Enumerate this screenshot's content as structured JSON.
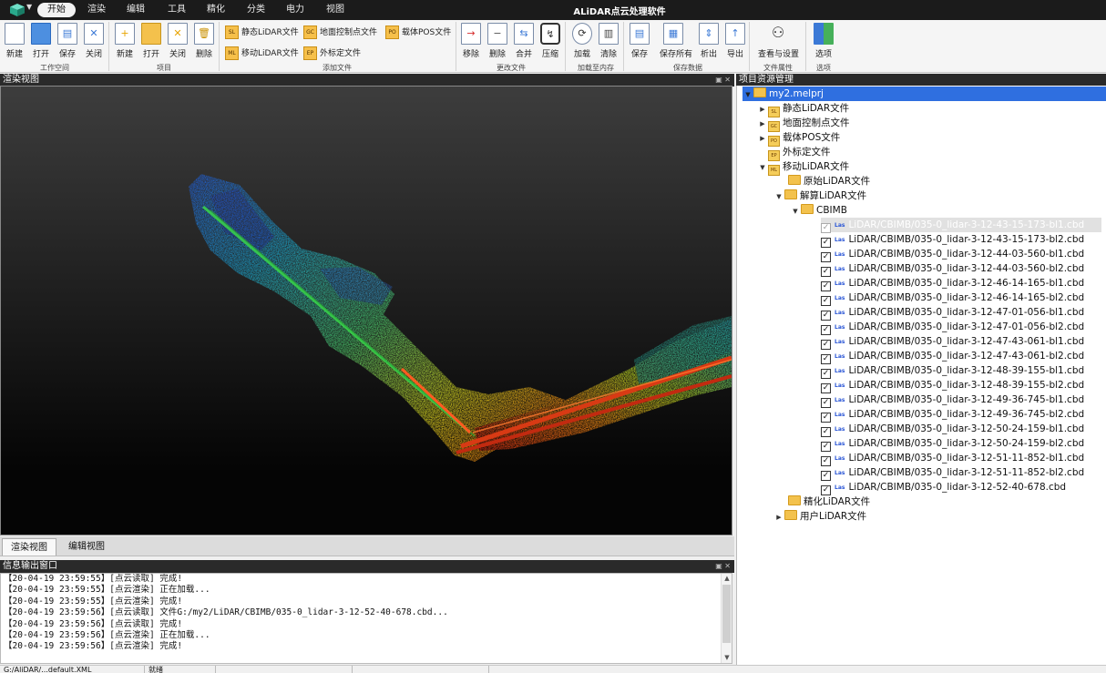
{
  "titlebar": {
    "app_title": "ALiDAR点云处理软件",
    "tabs": [
      "开始",
      "渲染",
      "编辑",
      "工具",
      "精化",
      "分类",
      "电力",
      "视图"
    ],
    "active_tab": 0,
    "app_icon": "cube-logo-icon"
  },
  "ribbon": {
    "groups": {
      "workspace": "工作空间",
      "project": "项目",
      "add_file": "添加文件",
      "change_file": "更改文件",
      "load_memory": "加载至内存",
      "save_data": "保存数据",
      "file_props": "文件属性",
      "options": "选项"
    },
    "workspace": {
      "new": "新建",
      "open": "打开",
      "save": "保存",
      "close": "关闭"
    },
    "project": {
      "new": "新建",
      "open": "打开",
      "close": "关闭",
      "delete": "删除"
    },
    "add_file": {
      "static_lidar": "静态LiDAR文件",
      "static_lidar_tag": "SL",
      "mobile_lidar": "移动LiDAR文件",
      "mobile_lidar_tag": "ML",
      "ground_control": "地面控制点文件",
      "ground_control_tag": "GC",
      "extrinsic": "外标定文件",
      "extrinsic_tag": "EP",
      "pos": "载体POS文件",
      "pos_tag": "PO"
    },
    "change_file": {
      "remove": "移除",
      "delete": "删除",
      "merge": "合并",
      "compress": "压缩"
    },
    "load_memory": {
      "load": "加载",
      "clear": "清除"
    },
    "save_data": {
      "save": "保存",
      "save_all": "保存所有",
      "extract": "析出",
      "export": "导出"
    },
    "file_props": {
      "view_settings": "查看与设置"
    },
    "options": {
      "options": "选项"
    }
  },
  "render_panel": {
    "title": "渲染视图",
    "tabs": [
      "渲染视图",
      "编辑视图"
    ],
    "active_tab": 0
  },
  "log_panel": {
    "title": "信息输出窗口",
    "lines": [
      "【20-04-19 23:59:55】[点云读取] 完成!",
      "【20-04-19 23:59:55】[点云渲染] 正在加载...",
      "【20-04-19 23:59:55】[点云渲染] 完成!",
      "【20-04-19 23:59:56】[点云读取] 文件G:/my2/LiDAR/CBIMB/035-0_lidar-3-12-52-40-678.cbd...",
      "【20-04-19 23:59:56】[点云读取] 完成!",
      "【20-04-19 23:59:56】[点云渲染] 正在加载...",
      "【20-04-19 23:59:56】[点云渲染] 完成!"
    ]
  },
  "tree_panel": {
    "title": "项目资源管理",
    "project": "my2.melprj",
    "static_lidar": "静态LiDAR文件",
    "static_lidar_tag": "SL",
    "ground_control": "地面控制点文件",
    "ground_control_tag": "GC",
    "pos": "载体POS文件",
    "pos_tag": "PO",
    "extrinsic": "外标定文件",
    "extrinsic_tag": "EP",
    "mobile_lidar": "移动LiDAR文件",
    "mobile_lidar_tag": "ML",
    "raw_lidar": "原始LiDAR文件",
    "solved_lidar": "解算LiDAR文件",
    "cbimb": "CBIMB",
    "las_tag": "Las",
    "files": [
      "LiDAR/CBIMB/035-0_lidar-3-12-43-15-173-bl1.cbd",
      "LiDAR/CBIMB/035-0_lidar-3-12-43-15-173-bl2.cbd",
      "LiDAR/CBIMB/035-0_lidar-3-12-44-03-560-bl1.cbd",
      "LiDAR/CBIMB/035-0_lidar-3-12-44-03-560-bl2.cbd",
      "LiDAR/CBIMB/035-0_lidar-3-12-46-14-165-bl1.cbd",
      "LiDAR/CBIMB/035-0_lidar-3-12-46-14-165-bl2.cbd",
      "LiDAR/CBIMB/035-0_lidar-3-12-47-01-056-bl1.cbd",
      "LiDAR/CBIMB/035-0_lidar-3-12-47-01-056-bl2.cbd",
      "LiDAR/CBIMB/035-0_lidar-3-12-47-43-061-bl1.cbd",
      "LiDAR/CBIMB/035-0_lidar-3-12-47-43-061-bl2.cbd",
      "LiDAR/CBIMB/035-0_lidar-3-12-48-39-155-bl1.cbd",
      "LiDAR/CBIMB/035-0_lidar-3-12-48-39-155-bl2.cbd",
      "LiDAR/CBIMB/035-0_lidar-3-12-49-36-745-bl1.cbd",
      "LiDAR/CBIMB/035-0_lidar-3-12-49-36-745-bl2.cbd",
      "LiDAR/CBIMB/035-0_lidar-3-12-50-24-159-bl1.cbd",
      "LiDAR/CBIMB/035-0_lidar-3-12-50-24-159-bl2.cbd",
      "LiDAR/CBIMB/035-0_lidar-3-12-51-11-852-bl1.cbd",
      "LiDAR/CBIMB/035-0_lidar-3-12-51-11-852-bl2.cbd",
      "LiDAR/CBIMB/035-0_lidar-3-12-52-40-678.cbd"
    ],
    "refined_lidar": "精化LiDAR文件",
    "user_lidar": "用户LiDAR文件"
  },
  "statusbar": {
    "path": "G:/AliDAR/...default.XML",
    "state": "就绪"
  }
}
